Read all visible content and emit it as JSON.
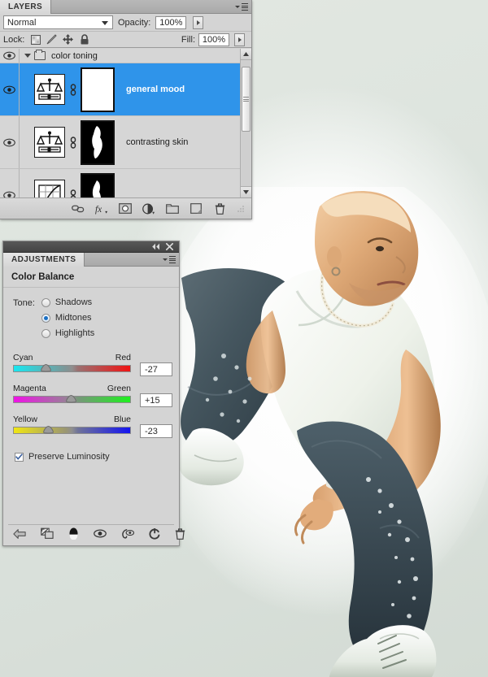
{
  "background": {
    "canvas_color": "#dfe5e0",
    "photo_alt": "dancer-photo"
  },
  "layers_panel": {
    "tab_label": "LAYERS",
    "menu_icon": "panel-menu-icon",
    "blend_mode": "Normal",
    "opacity_label": "Opacity:",
    "opacity_value": "100%",
    "lock_label": "Lock:",
    "lock_icons": [
      "lock-transparency-icon",
      "lock-image-icon",
      "lock-position-icon",
      "lock-all-icon"
    ],
    "fill_label": "Fill:",
    "fill_value": "100%",
    "selection_color": "#2f94ea",
    "rows": [
      {
        "type": "group",
        "name": "color toning",
        "visible": true,
        "expanded": true
      },
      {
        "type": "layer",
        "name": "general mood",
        "visible": true,
        "selected": true,
        "thumb_icon": "color-balance-icon",
        "mask": "white",
        "linked": true
      },
      {
        "type": "layer",
        "name": "contrasting skin",
        "visible": true,
        "selected": false,
        "thumb_icon": "color-balance-icon",
        "mask": "black",
        "linked": true
      },
      {
        "type": "layer",
        "name": "",
        "visible": true,
        "selected": false,
        "thumb_icon": "curves-icon",
        "mask": "black",
        "linked": true
      }
    ],
    "footer_icons": [
      "link-layers-icon",
      "layer-style-fx-icon",
      "add-layer-mask-icon",
      "new-adjustment-layer-icon",
      "new-group-icon",
      "new-layer-icon",
      "delete-layer-icon"
    ]
  },
  "adjustments_panel": {
    "collapse_icon": "collapse-to-icons-icon",
    "close_icon": "close-icon",
    "tab_label": "ADJUSTMENTS",
    "menu_icon": "panel-menu-icon",
    "title": "Color Balance",
    "tone": {
      "label": "Tone:",
      "options": [
        "Shadows",
        "Midtones",
        "Highlights"
      ],
      "selected": "Midtones"
    },
    "sliders": [
      {
        "left_label": "Cyan",
        "right_label": "Red",
        "value": "-27",
        "position_pct": 36.5
      },
      {
        "left_label": "Magenta",
        "right_label": "Green",
        "value": "+15",
        "position_pct": 57.5
      },
      {
        "left_label": "Yellow",
        "right_label": "Blue",
        "value": "-23",
        "position_pct": 38.5
      }
    ],
    "preserve_luminosity": {
      "label": "Preserve Luminosity",
      "checked": true
    },
    "footer_icons": [
      "return-to-adjustment-list-icon",
      "expand-panel-view-icon",
      "clip-to-layer-icon",
      "toggle-layer-visibility-icon",
      "view-previous-state-icon",
      "reset-adjustment-icon",
      "delete-adjustment-icon"
    ]
  }
}
